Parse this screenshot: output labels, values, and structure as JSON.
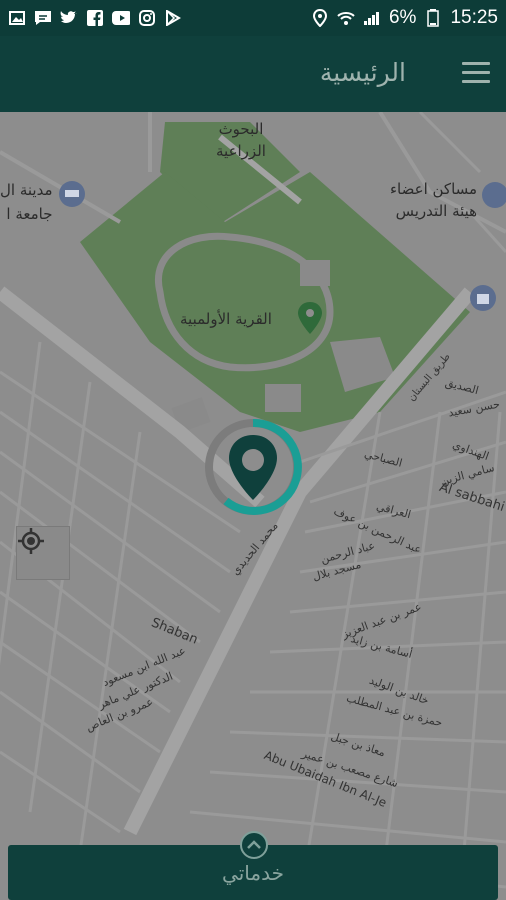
{
  "status_bar": {
    "left_icons": [
      "gallery-icon",
      "message-icon",
      "twitter-icon",
      "facebook-icon",
      "youtube-icon",
      "instagram-icon",
      "play-store-icon"
    ],
    "battery": "6%",
    "time": "15:25"
  },
  "app_bar": {
    "title": "الرئيسية",
    "menu_icon": "menu-icon"
  },
  "map": {
    "labels": {
      "research": "البحوث\nالزراعية",
      "olympic": "القرية الأولمبية",
      "faculty_housing": "مساكن اعضاء\nهيئة التدريس",
      "university_city": "مدينة ال\nجامعة ا",
      "sabbahi_en": "Al sabbahi",
      "shaban": "Shaban",
      "abu_ubaidah": "Abu Ubaidah Ibn Al-Je",
      "sadiq": "الصديق",
      "hassan_saeed": "حسن سعيد",
      "hindawi": "الهنداوي",
      "sami_zain": "سامي الزين",
      "sabahi": "الصباحي",
      "iraqi": "العراقي",
      "abdelrahman_ouf": "عبد الرحمن بن عوف",
      "obaid": "عباد الرحمن",
      "bilal": "مسجد بلال",
      "mohamed_hadidi": "محمد الحديدي",
      "omar_abdelaziz": "عمر بن عبد العزيز",
      "osama_zaid": "أسامة بن زايد",
      "khaled_walid": "خالد بن الوليد",
      "hamza": "حمزة بن عبد المطلب",
      "moaz": "معاذ بن جبل",
      "musab": "شارع مصعب بن عمير",
      "abdullah_masoud": "عبد الله ابن مسعود",
      "ali_maher": "الدكتور علي ماهر",
      "amr_aas": "عمرو بن العاص",
      "al_bustan": "طريق البستان"
    },
    "my_location_icon": "my-location-icon",
    "loading": true
  },
  "services": {
    "label": "خدماتي",
    "expand_icon": "chevron-up-icon"
  },
  "colors": {
    "app_bar": "#0f403c",
    "map_overlay": "#8c8c8c",
    "park_green": "#5f7f57",
    "spinner_accent": "#1a9e95"
  }
}
